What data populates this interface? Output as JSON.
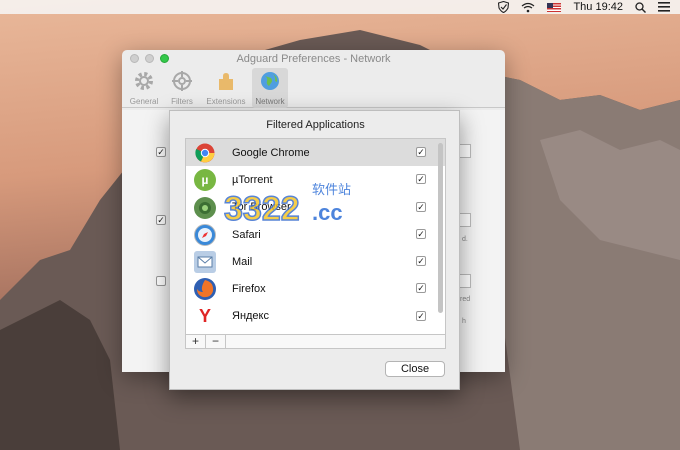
{
  "menubar": {
    "clock": "Thu 19:42"
  },
  "prefs": {
    "window_title": "Adguard Preferences - Network",
    "toolbar": [
      {
        "label": "General",
        "icon": "gear-icon"
      },
      {
        "label": "Filters",
        "icon": "filters-icon"
      },
      {
        "label": "Extensions",
        "icon": "extensions-icon"
      },
      {
        "label": "Network",
        "icon": "globe-icon"
      }
    ],
    "partial_text": [
      "d.",
      "red",
      "h"
    ]
  },
  "sheet": {
    "title": "Filtered Applications",
    "apps": [
      {
        "name": "Google Chrome",
        "checked": true,
        "selected": true,
        "icon": "chrome-icon",
        "color": "#4a8bd6"
      },
      {
        "name": "µTorrent",
        "checked": true,
        "selected": false,
        "icon": "utorrent-icon",
        "color": "#6db33f"
      },
      {
        "name": "Tor Browser",
        "checked": true,
        "selected": false,
        "icon": "tor-icon",
        "color": "#5a8a4a"
      },
      {
        "name": "Safari",
        "checked": true,
        "selected": false,
        "icon": "safari-icon",
        "color": "#3f86d4"
      },
      {
        "name": "Mail",
        "checked": true,
        "selected": false,
        "icon": "mail-icon",
        "color": "#7a9ec8"
      },
      {
        "name": "Firefox",
        "checked": true,
        "selected": false,
        "icon": "firefox-icon",
        "color": "#e8692a"
      },
      {
        "name": "Яндекс",
        "checked": true,
        "selected": false,
        "icon": "yandex-icon",
        "color": "#e02525"
      }
    ],
    "add_label": "+",
    "remove_label": "−",
    "close_label": "Close"
  },
  "watermark": {
    "main": "3322.cc",
    "sub": "软件站"
  }
}
